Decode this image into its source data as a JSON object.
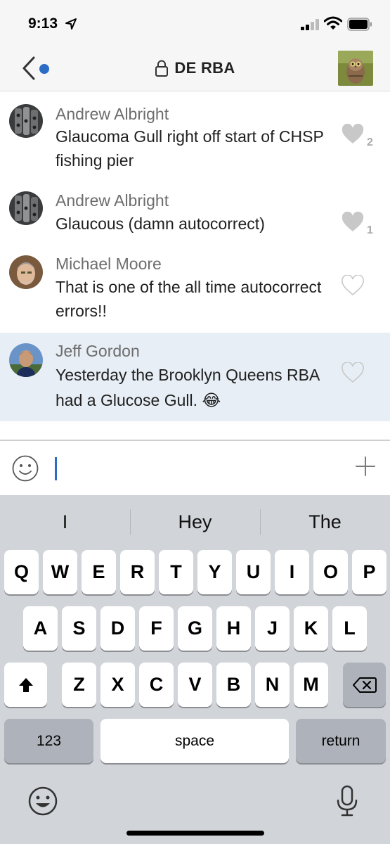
{
  "status_bar": {
    "time": "9:13"
  },
  "header": {
    "title": "DE RBA"
  },
  "messages": [
    {
      "author": "Andrew Albright",
      "text": "Glaucoma Gull right off start of CHSP fishing pier",
      "likes": "2",
      "liked": true
    },
    {
      "author": "Andrew Albright",
      "text": "Glaucous (damn autocorrect)",
      "likes": "1",
      "liked": true
    },
    {
      "author": "Michael Moore",
      "text": "That is one of the all time autocorrect errors!!",
      "likes": "",
      "liked": false
    },
    {
      "author": "Jeff Gordon",
      "text": "Yesterday the Brooklyn Queens RBA had a Glucose Gull. 😂",
      "likes": "",
      "liked": false
    }
  ],
  "composer": {
    "value": "",
    "placeholder": ""
  },
  "keyboard": {
    "suggestions": [
      "I",
      "Hey",
      "The"
    ],
    "row1": [
      "Q",
      "W",
      "E",
      "R",
      "T",
      "Y",
      "U",
      "I",
      "O",
      "P"
    ],
    "row2": [
      "A",
      "S",
      "D",
      "F",
      "G",
      "H",
      "J",
      "K",
      "L"
    ],
    "row3": [
      "Z",
      "X",
      "C",
      "V",
      "B",
      "N",
      "M"
    ],
    "numbers_label": "123",
    "space_label": "space",
    "return_label": "return"
  },
  "colors": {
    "accent": "#2b6cc4",
    "highlight_row": "#e7eef5",
    "keyboard_bg": "#d1d4d9",
    "liked_heart": "#c8c8c8"
  }
}
